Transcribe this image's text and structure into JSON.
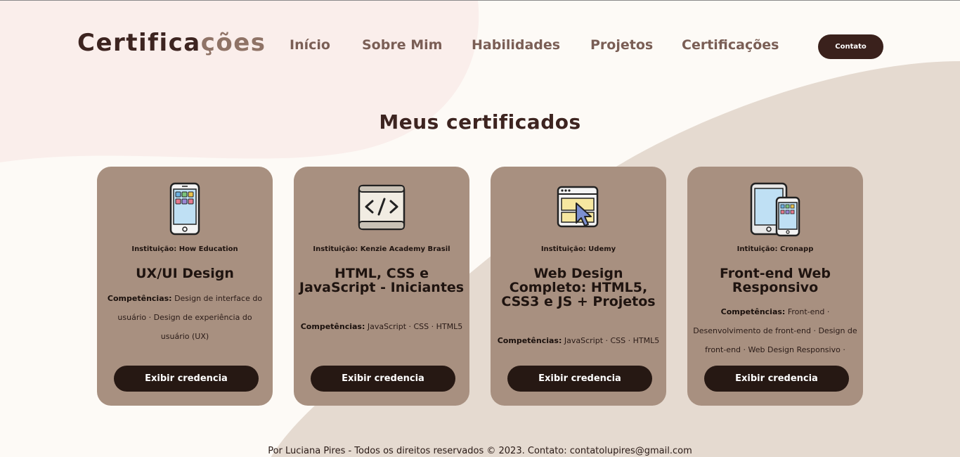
{
  "header": {
    "logo_main": "Certifica",
    "logo_accent": "ções",
    "nav": [
      "Início",
      "Sobre Mim",
      "Habilidades",
      "Projetos",
      "Certificações"
    ],
    "contact_label": "Contato"
  },
  "section": {
    "title": "Meus certificados"
  },
  "cards": [
    {
      "icon": "smartphone-icon",
      "institution": "Instituição: How Education",
      "title": "UX/UI Design",
      "skills_label": "Competências:",
      "skills": "Design de interface do usuário · Design de experiência do usuário (UX)",
      "button": "Exibir credencia"
    },
    {
      "icon": "code-window-icon",
      "institution": "Instituição: Kenzie Academy Brasil",
      "title": "HTML, CSS e JavaScript - Iniciantes",
      "skills_label": "Competências:",
      "skills": "JavaScript · CSS · HTML5",
      "button": "Exibir credencia"
    },
    {
      "icon": "browser-cursor-icon",
      "institution": "Instituição: Udemy",
      "title": "Web Design Completo: HTML5, CSS3 e JS + Projetos",
      "skills_label": "Competências:",
      "skills": "JavaScript · CSS · HTML5",
      "button": "Exibir credencia"
    },
    {
      "icon": "responsive-devices-icon",
      "institution": "Intituição: Cronapp",
      "title": "Front-end Web Responsivo",
      "skills_label": "Competências:",
      "skills": "Front-end · Desenvolvimento de front-end · Design de front-end · Web Design Responsivo ·",
      "button": "Exibir credencia"
    }
  ],
  "footer": {
    "text": "Por Luciana Pires - Todos os direitos reservados © 2023. Contato: contatolupires@gmail.com"
  },
  "colors": {
    "background": "#fdfaf6",
    "blob_pink": "#faeeeb",
    "blob_beige": "#e5dad0",
    "card": "#a89080",
    "button_dark": "#261813",
    "nav_text": "#7a5e55",
    "title_dark": "#3d2420"
  }
}
